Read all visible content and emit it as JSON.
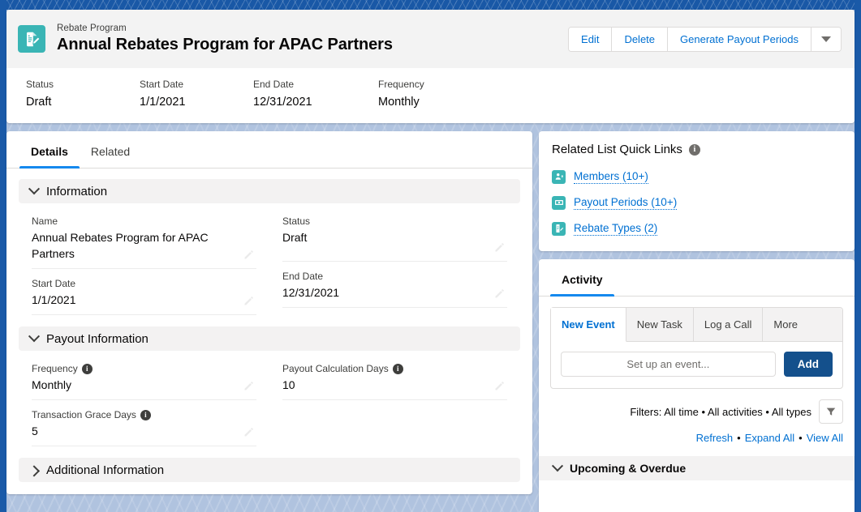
{
  "header": {
    "object_label": "Rebate Program",
    "record_title": "Annual Rebates Program for APAC Partners",
    "app_icon": "document-edit-icon",
    "actions": [
      {
        "label": "Edit",
        "name": "edit-button"
      },
      {
        "label": "Delete",
        "name": "delete-button"
      },
      {
        "label": "Generate Payout Periods",
        "name": "generate-payout-periods-button"
      }
    ],
    "more_actions_icon": "chevron-down-icon",
    "highlight_fields": [
      {
        "label": "Status",
        "value": "Draft"
      },
      {
        "label": "Start Date",
        "value": "1/1/2021"
      },
      {
        "label": "End Date",
        "value": "12/31/2021"
      },
      {
        "label": "Frequency",
        "value": "Monthly"
      }
    ]
  },
  "details": {
    "tabs": [
      {
        "label": "Details",
        "active": true
      },
      {
        "label": "Related",
        "active": false
      }
    ],
    "sections": {
      "information": {
        "title": "Information",
        "expanded": true,
        "fields": {
          "name": {
            "label": "Name",
            "value": "Annual Rebates Program for APAC Partners"
          },
          "status": {
            "label": "Status",
            "value": "Draft"
          },
          "start_date": {
            "label": "Start Date",
            "value": "1/1/2021"
          },
          "end_date": {
            "label": "End Date",
            "value": "12/31/2021"
          }
        }
      },
      "payout": {
        "title": "Payout Information",
        "expanded": true,
        "fields": {
          "frequency": {
            "label": "Frequency",
            "value": "Monthly",
            "has_info": true
          },
          "payout_calculation_days": {
            "label": "Payout Calculation Days",
            "value": "10",
            "has_info": true
          },
          "transaction_grace_days": {
            "label": "Transaction Grace Days",
            "value": "5",
            "has_info": true
          }
        }
      },
      "additional": {
        "title": "Additional Information",
        "expanded": false
      }
    }
  },
  "quick_links": {
    "title": "Related List Quick Links",
    "info_icon": "info-icon",
    "items": [
      {
        "label": "Members (10+)",
        "icon": "members-icon"
      },
      {
        "label": "Payout Periods (10+)",
        "icon": "payout-periods-icon"
      },
      {
        "label": "Rebate Types (2)",
        "icon": "rebate-types-icon"
      }
    ]
  },
  "activity": {
    "tab_label": "Activity",
    "composer_tabs": [
      {
        "label": "New Event",
        "active": true
      },
      {
        "label": "New Task",
        "active": false
      },
      {
        "label": "Log a Call",
        "active": false
      },
      {
        "label": "More",
        "active": false
      }
    ],
    "event_input_placeholder": "Set up an event...",
    "event_input_value": "",
    "add_label": "Add",
    "filters_text": "Filters: All time • All activities • All types",
    "filter_icon": "funnel-icon",
    "links": [
      {
        "label": "Refresh"
      },
      {
        "label": "Expand All"
      },
      {
        "label": "View All"
      }
    ],
    "link_separator": "•",
    "upcoming_label": "Upcoming & Overdue"
  },
  "colors": {
    "brand_blue": "#0070d2",
    "accent_teal": "#3ab5b5",
    "active_tab_underline": "#1589ee",
    "add_button": "#14508c",
    "page_background": "#b0c3df",
    "top_strip": "#1958a6"
  }
}
